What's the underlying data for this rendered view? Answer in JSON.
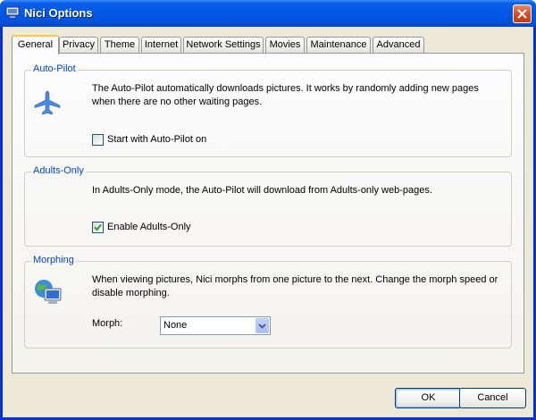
{
  "window": {
    "title": "Nici Options"
  },
  "tabs": [
    "General",
    "Privacy",
    "Theme",
    "Internet",
    "Network Settings",
    "Movies",
    "Maintenance",
    "Advanced"
  ],
  "groups": {
    "autopilot": {
      "label": "Auto-Pilot",
      "description": "The Auto-Pilot automatically downloads pictures. It works by randomly adding new pages when there are no other waiting pages.",
      "checkbox_label": "Start with Auto-Pilot on",
      "checked": false,
      "icon": "airplane-icon"
    },
    "adults": {
      "label": "Adults-Only",
      "description": "In Adults-Only mode, the Auto-Pilot will download from Adults-only web-pages.",
      "checkbox_label": "Enable Adults-Only",
      "checked": true
    },
    "morphing": {
      "label": "Morphing",
      "description": "When viewing pictures, Nici morphs from one picture to the next. Change the morph speed or disable morphing.",
      "morph_label": "Morph:",
      "morph_value": "None",
      "icon": "monitor-globe-icon"
    }
  },
  "buttons": {
    "ok": "OK",
    "cancel": "Cancel"
  },
  "colors": {
    "title_bar": "#0058e6",
    "group_label": "#0046d5",
    "active_tab_highlight": "#ffc83c",
    "dialog_bg": "#ece9d8"
  }
}
